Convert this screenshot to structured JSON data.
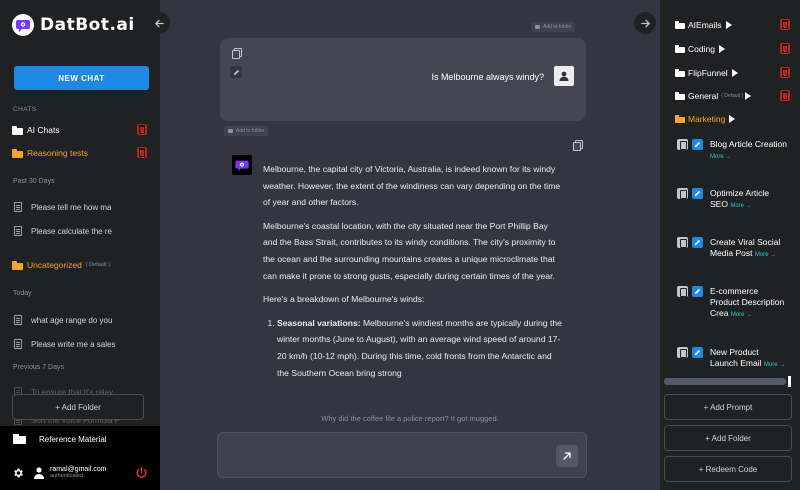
{
  "app": {
    "logo_text": "DatBot.ai"
  },
  "left": {
    "new_chat_label": "NEW CHAT",
    "chats_label": "CHATS",
    "folders": [
      {
        "name": "AI Chats",
        "color": "#ffffff"
      },
      {
        "name": "Reasoning tests",
        "color": "#f5a623"
      }
    ],
    "group_past30": "Past 30 Days",
    "past30_chats": [
      "Please tell me how ma",
      "Please calculate the re"
    ],
    "uncategorized_label": "Uncategorized",
    "uncategorized_sub": "( Default )",
    "group_today": "Today",
    "today_chats": [
      "what age range do you",
      "Please write me a sales"
    ],
    "group_prev7": "Previous 7 Days",
    "prev7_chats": [
      "To ensure that it's relev",
      "Sort the Voice Formula P"
    ],
    "add_folder_label": "+ Add Folder",
    "reference_material": "Reference Material",
    "user_email": "ramal@gmail.com",
    "user_status": "authenticated"
  },
  "center": {
    "add_to_folder": "Add to folder",
    "user_question": "Is Melbourne always windy?",
    "answer_paragraphs": [
      "Melbourne, the capital city of Victoria, Australia, is indeed known for its windy weather. However, the extent of the windiness can vary depending on the time of year and other factors.",
      "Melbourne's coastal location, with the city situated near the Port Phillip Bay and the Bass Strait, contributes to its windy conditions. The city's proximity to the ocean and the surrounding mountains creates a unique microclimate that can make it prone to strong gusts, especially during certain times of the year.",
      "Here's a breakdown of Melbourne's winds:"
    ],
    "answer_list": [
      {
        "title": "Seasonal variations:",
        "text": " Melbourne's windiest months are typically during the winter months (June to August), with an average wind speed of around 17-20 km/h (10-12 mph). During this time, cold fronts from the Antarctic and the Southern Ocean bring strong"
      }
    ],
    "joke": "Why did the coffee file a police report? It got mugged.",
    "input_placeholder": ""
  },
  "right": {
    "folders": [
      {
        "name": "AIEmails"
      },
      {
        "name": "Coding"
      },
      {
        "name": "FlipFunnel"
      },
      {
        "name": "General",
        "sub": "( Default )"
      },
      {
        "name": "Marketing"
      }
    ],
    "prompts": [
      {
        "title": "Blog Article Creation",
        "more": "More →"
      },
      {
        "title": "Optimize Article SEO",
        "more": "More →"
      },
      {
        "title": "Create Viral Social Media Post",
        "more": "More →"
      },
      {
        "title": "E-commerce Product Description Crea",
        "more": "More →"
      },
      {
        "title": "New Product Launch Email",
        "more": "More →"
      }
    ],
    "add_prompt_label": "+ Add Prompt",
    "add_folder_label": "+ Add Folder",
    "redeem_code_label": "+ Redeem Code"
  },
  "colors": {
    "accent": "#1e88e5",
    "folder_orange": "#f5a623",
    "trash_red": "#b3261e",
    "more_link": "#26c6da"
  }
}
